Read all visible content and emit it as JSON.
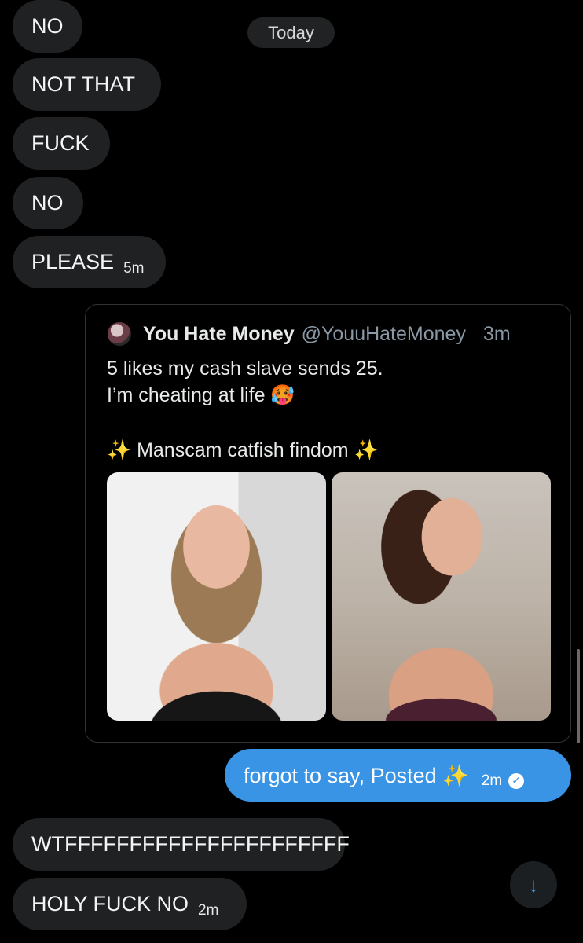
{
  "date_separator": "Today",
  "incoming_messages_top": [
    {
      "text": "NO",
      "time": ""
    },
    {
      "text": "NOT THAT",
      "time": ""
    },
    {
      "text": "FUCK",
      "time": ""
    },
    {
      "text": "NO",
      "time": ""
    },
    {
      "text": "PLEASE",
      "time": "5m"
    }
  ],
  "quoted_post": {
    "avatar_icon": "profile-avatar",
    "display_name": "You Hate Money",
    "handle": "@YouuHateMoney",
    "time": "3m",
    "text_line1": "5 likes my cash slave sends 25.",
    "text_line2": "I’m cheating at life 🥵",
    "text_line3": "✨ Manscam catfish findom ✨",
    "media_count": 2
  },
  "outgoing_message": {
    "text": "forgot to say, Posted ✨",
    "time": "2m",
    "status_icon": "read-check-icon",
    "bubble_color": "#3a94e6"
  },
  "incoming_messages_bottom": [
    {
      "text": "WTFFFFFFFFFFFFFFFFFFFFFF",
      "time": ""
    },
    {
      "text": "HOLY FUCK NO",
      "time": "2m"
    }
  ],
  "scroll_button": {
    "icon": "↓"
  }
}
